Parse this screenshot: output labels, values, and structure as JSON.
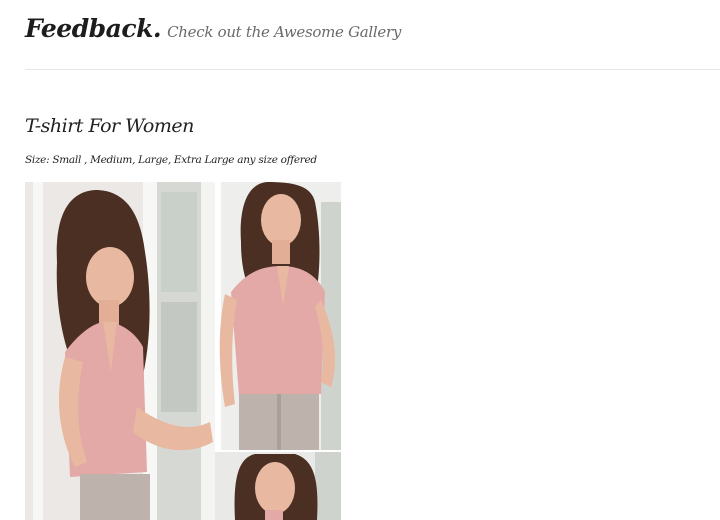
{
  "header": {
    "brand": "Feedback.",
    "tagline": "Check out the Awesome Gallery"
  },
  "product": {
    "title": "T-shirt For Women",
    "sizes": "Size: Small , Medium, Large, Extra Large any size offered",
    "image_icon": "product-photo",
    "colors": {
      "top": "#e3a9a6",
      "skin": "#e8b8a0",
      "hair": "#4a2f22",
      "trousers": "#bdb2ac",
      "window": "#f2f2f0"
    }
  }
}
